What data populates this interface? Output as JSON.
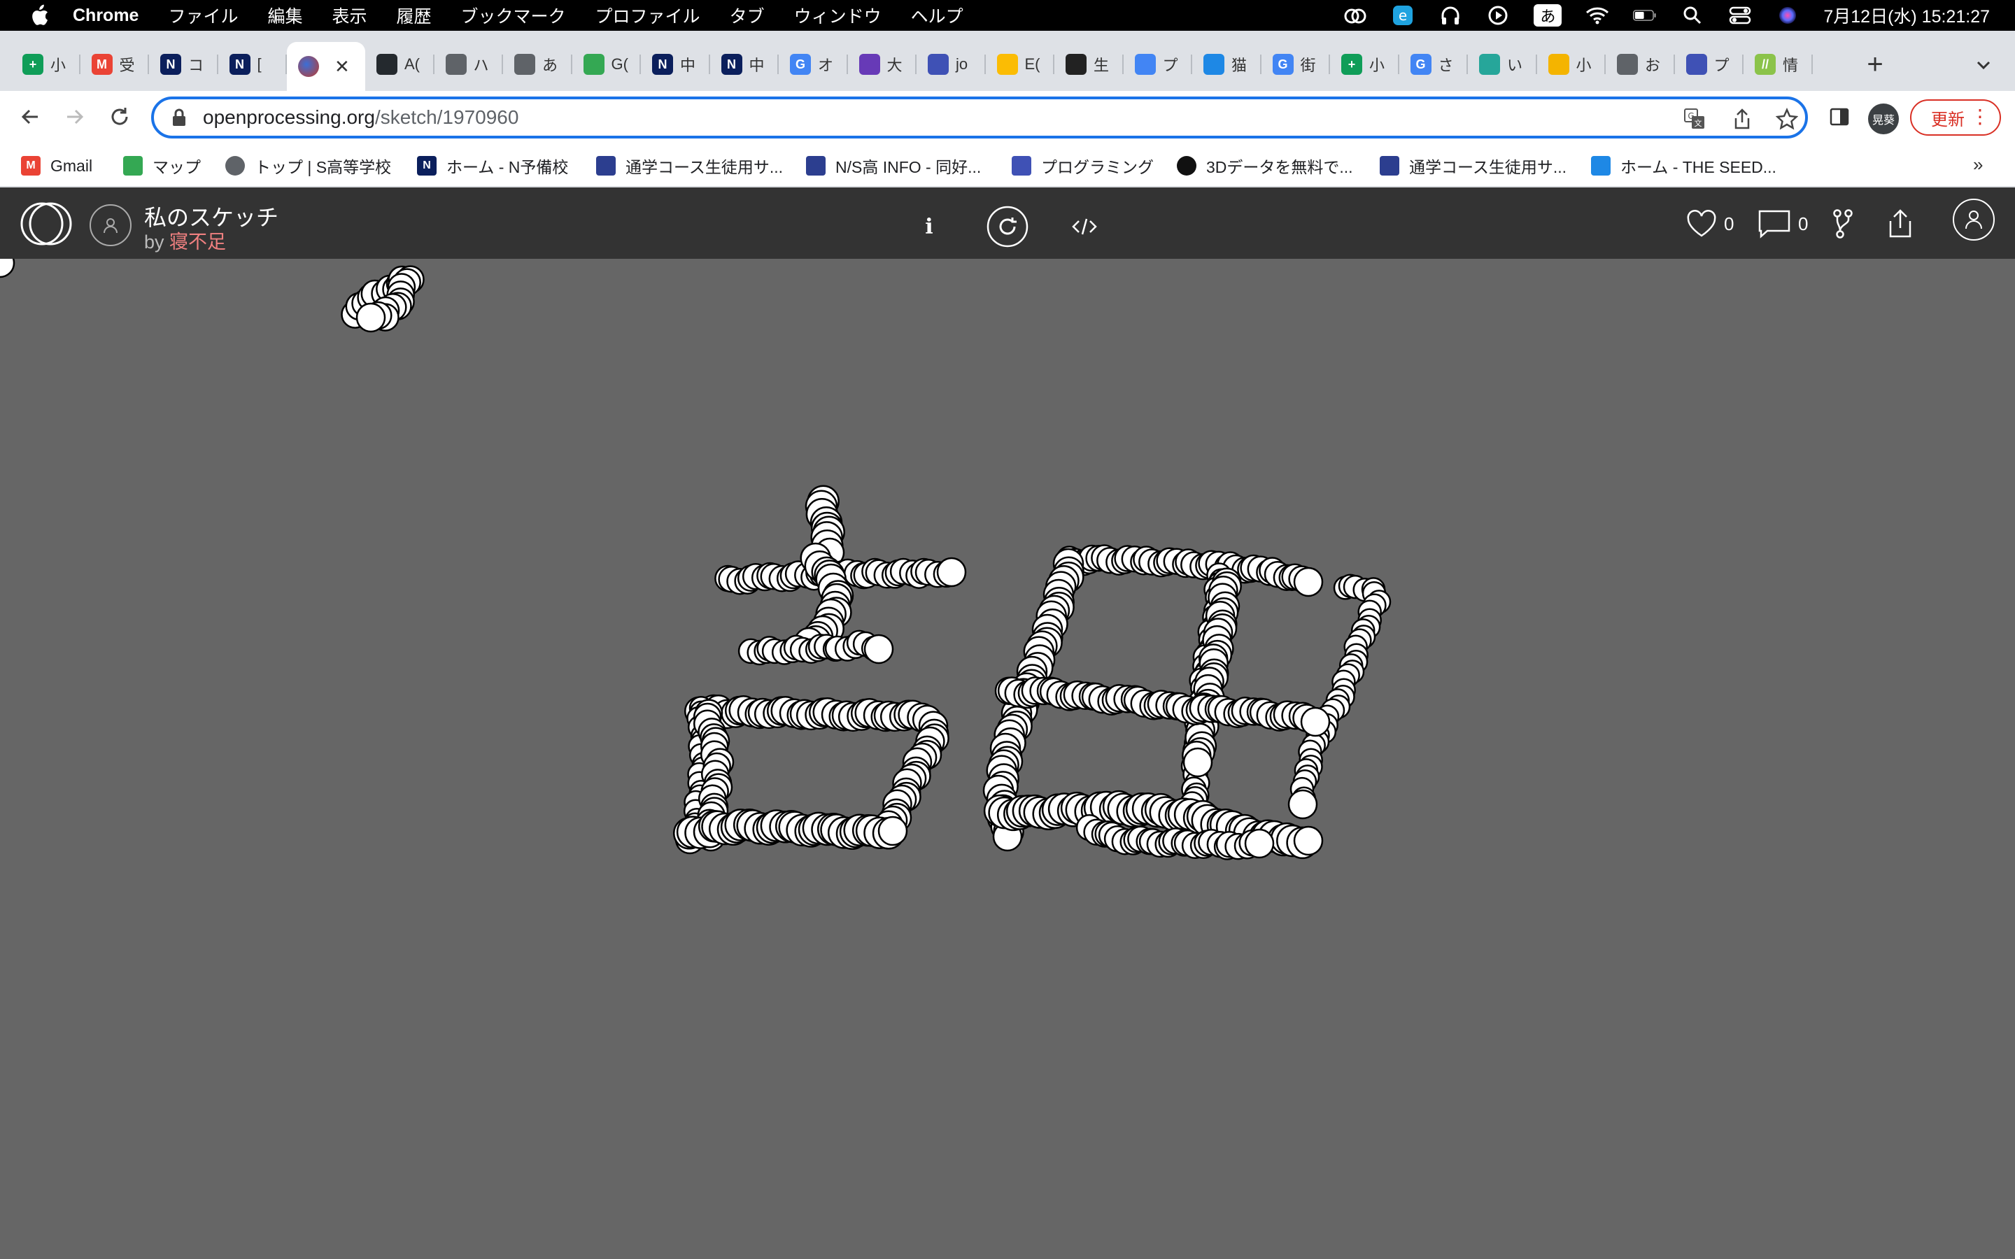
{
  "menubar": {
    "app_name": "Chrome",
    "items": [
      "ファイル",
      "編集",
      "表示",
      "履歴",
      "ブックマーク",
      "プロファイル",
      "タブ",
      "ウィンドウ",
      "ヘルプ"
    ],
    "ime": "あ",
    "datetime": "7月12日(水)  15:21:27"
  },
  "tabs": [
    {
      "label": "小",
      "color": "#0f9d58",
      "glyph": "+"
    },
    {
      "label": "受",
      "color": "#ea4335",
      "glyph": "M"
    },
    {
      "label": "コ",
      "color": "#0b1f5c",
      "glyph": "N"
    },
    {
      "label": "[",
      "color": "#0b1f5c",
      "glyph": "N"
    },
    {
      "label": "",
      "color": "#c0392b",
      "glyph": "",
      "active": true
    },
    {
      "label": "A(",
      "color": "#24292e",
      "glyph": ""
    },
    {
      "label": "ハ",
      "color": "#5f6368",
      "glyph": ""
    },
    {
      "label": "あ",
      "color": "#5f6368",
      "glyph": ""
    },
    {
      "label": "G(",
      "color": "#34a853",
      "glyph": ""
    },
    {
      "label": "中",
      "color": "#0b1f5c",
      "glyph": "N"
    },
    {
      "label": "中",
      "color": "#0b1f5c",
      "glyph": "N"
    },
    {
      "label": "オ",
      "color": "#4285f4",
      "glyph": "G"
    },
    {
      "label": "大",
      "color": "#673ab7",
      "glyph": ""
    },
    {
      "label": "jo",
      "color": "#3f51b5",
      "glyph": ""
    },
    {
      "label": "E(",
      "color": "#fbbc04",
      "glyph": ""
    },
    {
      "label": "生",
      "color": "#222",
      "glyph": ""
    },
    {
      "label": "プ",
      "color": "#4285f4",
      "glyph": ""
    },
    {
      "label": "猫",
      "color": "#1e88e5",
      "glyph": ""
    },
    {
      "label": "街",
      "color": "#4285f4",
      "glyph": "G"
    },
    {
      "label": "小",
      "color": "#0f9d58",
      "glyph": "+"
    },
    {
      "label": "さ",
      "color": "#4285f4",
      "glyph": "G"
    },
    {
      "label": "い",
      "color": "#26a69a",
      "glyph": ""
    },
    {
      "label": "小",
      "color": "#f4b400",
      "glyph": ""
    },
    {
      "label": "お",
      "color": "#5f6368",
      "glyph": ""
    },
    {
      "label": "プ",
      "color": "#3f51b5",
      "glyph": ""
    },
    {
      "label": "情",
      "color": "#8bc34a",
      "glyph": "//"
    }
  ],
  "toolbar": {
    "url_domain": "openprocessing.org",
    "url_path": "/sketch/1970960",
    "profile_chip": "晃葵",
    "update_label": "更新"
  },
  "bookmarks": [
    {
      "label": "Gmail",
      "icon": "gmail-icon",
      "color": "#ea4335",
      "glyph": "M"
    },
    {
      "label": "マップ",
      "icon": "maps-icon",
      "color": "#34a853",
      "glyph": ""
    },
    {
      "label": "トップ | S高等学校",
      "icon": "globe-icon",
      "color": "#5f6368",
      "glyph": ""
    },
    {
      "label": "ホーム - N予備校",
      "icon": "n-icon",
      "color": "#0b1f5c",
      "glyph": "N"
    },
    {
      "label": "通学コース生徒用サ...",
      "icon": "n-logo-icon",
      "color": "#2c3e8f",
      "glyph": ""
    },
    {
      "label": "N/S高 INFO - 同好...",
      "icon": "n-logo-icon",
      "color": "#2c3e8f",
      "glyph": ""
    },
    {
      "label": "プログラミング",
      "icon": "forms-icon",
      "color": "#3f51b5",
      "glyph": ""
    },
    {
      "label": "3Dデータを無料で...",
      "icon": "aperture-icon",
      "color": "#111",
      "glyph": ""
    },
    {
      "label": "通学コース生徒用サ...",
      "icon": "n-logo-icon",
      "color": "#2c3e8f",
      "glyph": ""
    },
    {
      "label": "ホーム - THE SEED...",
      "icon": "seed-icon",
      "color": "#1e88e5",
      "glyph": ""
    }
  ],
  "sketch": {
    "title": "私のスケッチ",
    "by": "by",
    "author": "寝不足",
    "likes": "0",
    "comments": "0",
    "info_glyph": "i"
  }
}
